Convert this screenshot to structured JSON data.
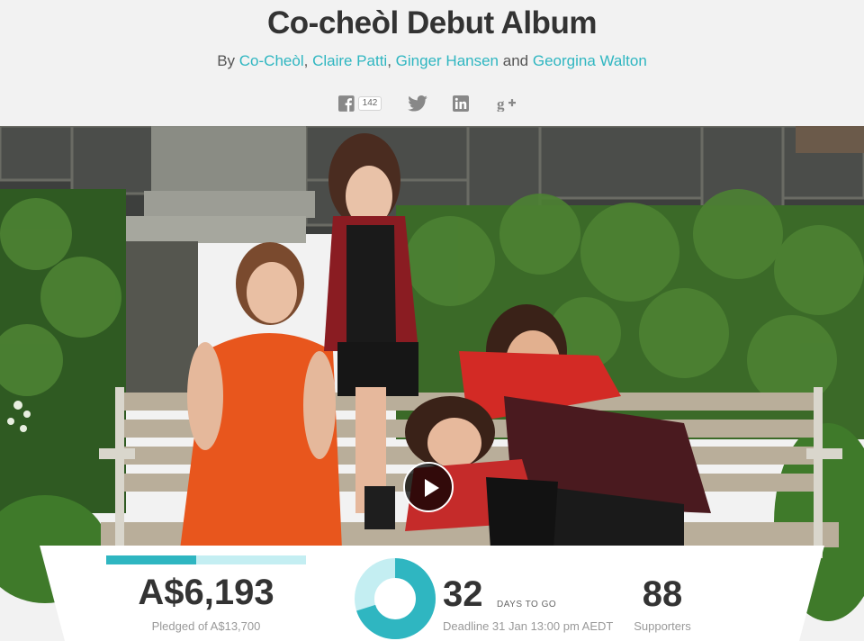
{
  "page": {
    "title": "Co-cheòl Debut Album",
    "byline": {
      "prefix": "By",
      "creators": [
        "Co-Cheòl",
        "Claire Patti",
        "Ginger Hansen",
        "Georgina Walton"
      ],
      "sep1": ",",
      "sep2": ",",
      "conj": "and"
    }
  },
  "social": {
    "facebook_count": "142",
    "icons": [
      "facebook-icon",
      "twitter-icon",
      "linkedin-icon",
      "google-plus-icon"
    ]
  },
  "colors": {
    "accent": "#2fb6c1",
    "accent_light": "#c4eef2",
    "text": "#333333",
    "muted": "#999999"
  },
  "stats": {
    "pledged": "A$6,193",
    "pledged_of": "Pledged of  A$13,700",
    "progress_fraction": 0.452,
    "days": "32",
    "days_label": "DAYS TO GO",
    "deadline": "Deadline 31 Jan 13:00 pm AEDT",
    "supporters": "88",
    "supporters_label": "Supporters",
    "time_remaining_fraction": 0.7
  }
}
